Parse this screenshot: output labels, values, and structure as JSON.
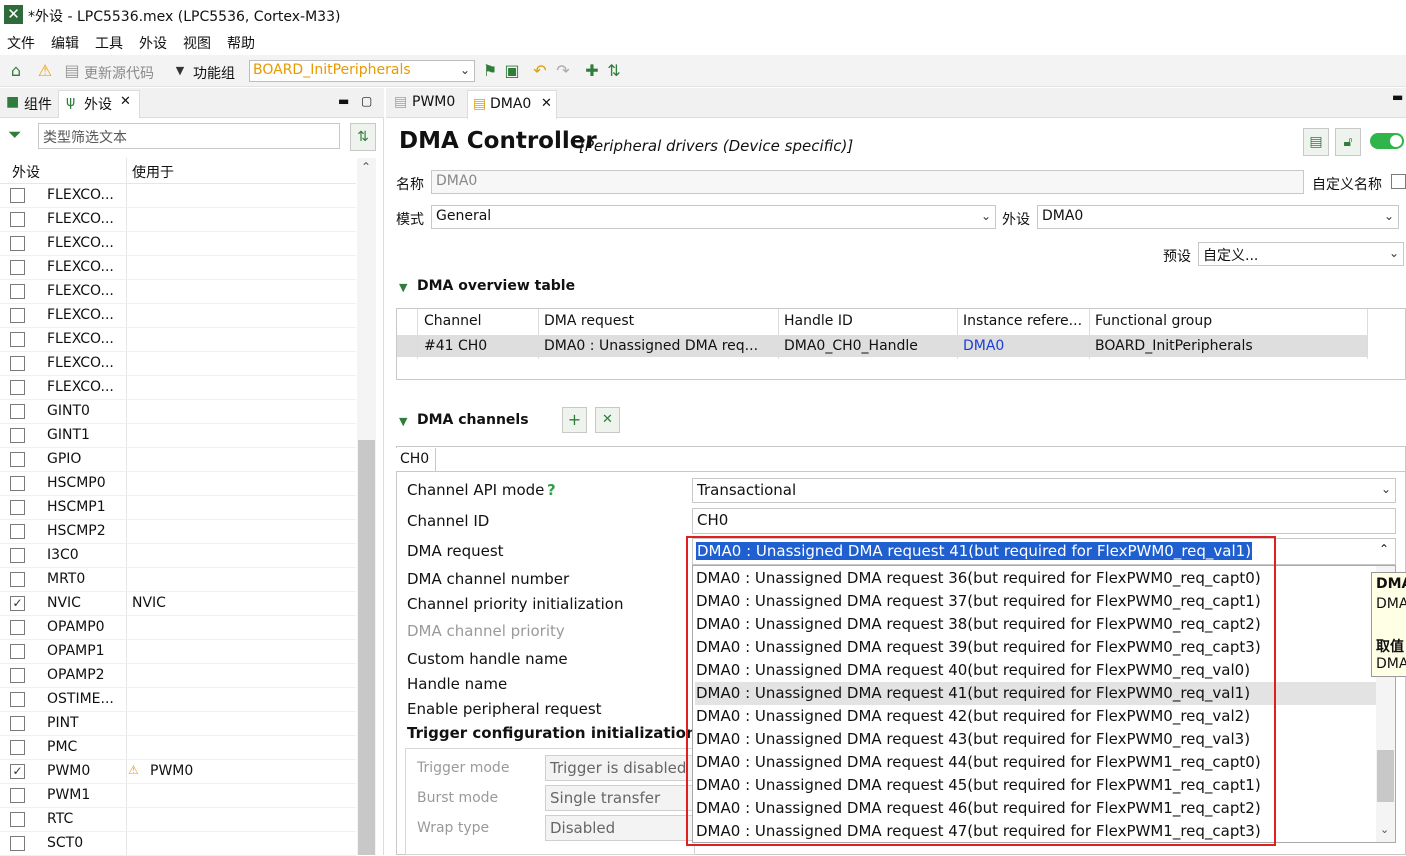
{
  "window": {
    "title": "*外设 - LPC5536.mex (LPC5536, Cortex-M33)"
  },
  "menu": [
    "文件",
    "编辑",
    "工具",
    "外设",
    "视图",
    "帮助"
  ],
  "toolbar": {
    "update_label": "更新源代码",
    "funcgroup_label": "功能组",
    "funcgroup_value": "BOARD_InitPeripherals",
    "colors": {
      "funcgroup_value": "#e59a00",
      "accent": "#2f7d3a"
    }
  },
  "left_panel": {
    "tabs": [
      "组件",
      "外设"
    ],
    "filter_placeholder": "类型筛选文本",
    "columns": [
      "外设",
      "使用于"
    ],
    "rows": [
      {
        "name": "FLEXCO...",
        "checked": false,
        "used": ""
      },
      {
        "name": "FLEXCO...",
        "checked": false,
        "used": ""
      },
      {
        "name": "FLEXCO...",
        "checked": false,
        "used": ""
      },
      {
        "name": "FLEXCO...",
        "checked": false,
        "used": ""
      },
      {
        "name": "FLEXCO...",
        "checked": false,
        "used": ""
      },
      {
        "name": "FLEXCO...",
        "checked": false,
        "used": ""
      },
      {
        "name": "FLEXCO...",
        "checked": false,
        "used": ""
      },
      {
        "name": "FLEXCO...",
        "checked": false,
        "used": ""
      },
      {
        "name": "FLEXCO...",
        "checked": false,
        "used": ""
      },
      {
        "name": "GINT0",
        "checked": false,
        "used": ""
      },
      {
        "name": "GINT1",
        "checked": false,
        "used": ""
      },
      {
        "name": "GPIO",
        "checked": false,
        "used": ""
      },
      {
        "name": "HSCMP0",
        "checked": false,
        "used": ""
      },
      {
        "name": "HSCMP1",
        "checked": false,
        "used": ""
      },
      {
        "name": "HSCMP2",
        "checked": false,
        "used": ""
      },
      {
        "name": "I3C0",
        "checked": false,
        "used": ""
      },
      {
        "name": "MRT0",
        "checked": false,
        "used": ""
      },
      {
        "name": "NVIC",
        "checked": true,
        "used": "NVIC"
      },
      {
        "name": "OPAMP0",
        "checked": false,
        "used": ""
      },
      {
        "name": "OPAMP1",
        "checked": false,
        "used": ""
      },
      {
        "name": "OPAMP2",
        "checked": false,
        "used": ""
      },
      {
        "name": "OSTIME...",
        "checked": false,
        "used": ""
      },
      {
        "name": "PINT",
        "checked": false,
        "used": ""
      },
      {
        "name": "PMC",
        "checked": false,
        "used": ""
      },
      {
        "name": "PWM0",
        "checked": true,
        "used": "PWM0",
        "warn": true
      },
      {
        "name": "PWM1",
        "checked": false,
        "used": ""
      },
      {
        "name": "RTC",
        "checked": false,
        "used": ""
      },
      {
        "name": "SCT0",
        "checked": false,
        "used": ""
      }
    ]
  },
  "editor": {
    "tabs": [
      "PWM0",
      "DMA0"
    ],
    "title": "DMA Controller",
    "subtitle": "[Peripheral drivers (Device specific)]",
    "name_label": "名称",
    "name_value": "DMA0",
    "custom_name_label": "自定义名称",
    "mode_label": "模式",
    "mode_value": "General",
    "peripheral_label": "外设",
    "peripheral_value": "DMA0",
    "preset_label": "预设",
    "preset_value": "自定义...",
    "overview": {
      "title": "DMA overview table",
      "columns": [
        "Channel",
        "DMA request",
        "Handle ID",
        "Instance refere...",
        "Functional group"
      ],
      "row": [
        "#41 CH0",
        "DMA0 : Unassigned DMA req...",
        "DMA0_CH0_Handle",
        "DMA0",
        "BOARD_InitPeripherals"
      ]
    },
    "channels": {
      "title": "DMA channels",
      "add_glyph": "+",
      "remove_glyph": "✕",
      "tab": "CH0",
      "labels": [
        "Channel API mode",
        "Channel ID",
        "DMA request",
        "DMA channel number",
        "Channel priority initialization",
        "DMA channel priority",
        "Custom handle name",
        "Handle name",
        "Enable peripheral request",
        "Trigger configuration initialization"
      ],
      "api_mode_value": "Transactional",
      "channel_id_value": "CH0",
      "dma_request_selected": "DMA0 : Unassigned DMA request 41(but required for FlexPWM0_req_val1)",
      "trigger": {
        "labels": [
          "Trigger mode",
          "Burst mode",
          "Wrap type"
        ],
        "values": [
          "Trigger is disabled",
          "Single transfer",
          "Disabled"
        ]
      }
    },
    "dropdown": {
      "items": [
        "DMA0 : Unassigned DMA request 36(but required for FlexPWM0_req_capt0)",
        "DMA0 : Unassigned DMA request 37(but required for FlexPWM0_req_capt1)",
        "DMA0 : Unassigned DMA request 38(but required for FlexPWM0_req_capt2)",
        "DMA0 : Unassigned DMA request 39(but required for FlexPWM0_req_capt3)",
        "DMA0 : Unassigned DMA request 40(but required for FlexPWM0_req_val0)",
        "DMA0 : Unassigned DMA request 41(but required for FlexPWM0_req_val1)",
        "DMA0 : Unassigned DMA request 42(but required for FlexPWM0_req_val2)",
        "DMA0 : Unassigned DMA request 43(but required for FlexPWM0_req_val3)",
        "DMA0 : Unassigned DMA request 44(but required for FlexPWM1_req_capt0)",
        "DMA0 : Unassigned DMA request 45(but required for FlexPWM1_req_capt1)",
        "DMA0 : Unassigned DMA request 46(but required for FlexPWM1_req_capt2)",
        "DMA0 : Unassigned DMA request 47(but required for FlexPWM1_req_capt3)"
      ],
      "highlighted_index": 5
    },
    "tooltip": {
      "lines": [
        "DMA",
        "DMA",
        "取值",
        "DMA"
      ]
    }
  }
}
